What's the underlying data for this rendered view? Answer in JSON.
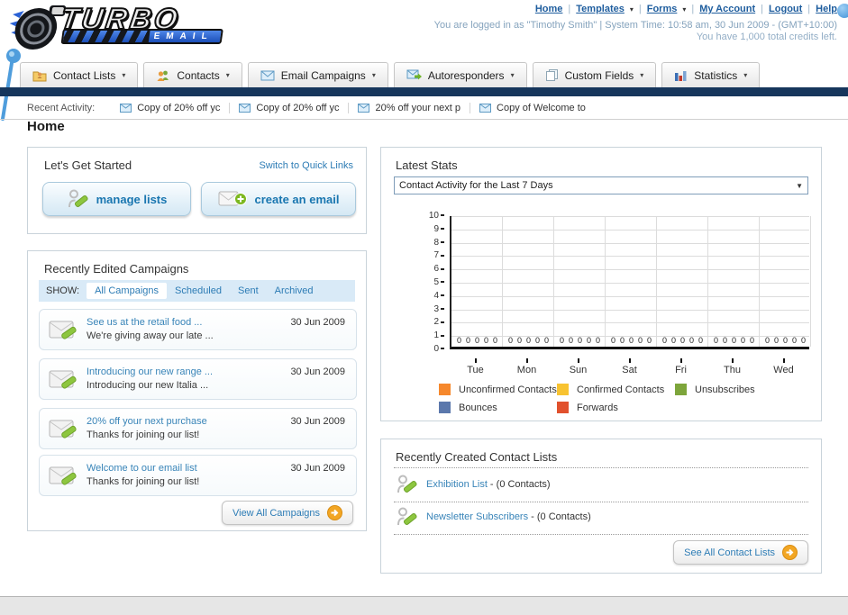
{
  "header": {
    "logo": {
      "title": "TURBO",
      "subtitle": "EMAIL"
    },
    "nav_links": [
      "Home",
      "Templates",
      "Forms",
      "My Account",
      "Logout",
      "Help"
    ],
    "login_line1": "You are logged in as \"Timothy Smith\" | System Time: 10:58 am, 30 Jun 2009 - (GMT+10:00)",
    "login_line2": "You have 1,000 total credits left."
  },
  "tabs": [
    {
      "label": "Contact Lists"
    },
    {
      "label": "Contacts"
    },
    {
      "label": "Email Campaigns"
    },
    {
      "label": "Autoresponders"
    },
    {
      "label": "Custom Fields"
    },
    {
      "label": "Statistics"
    }
  ],
  "recent_activity": {
    "label": "Recent Activity:",
    "items": [
      "Copy of 20% off yc",
      "Copy of 20% off yc",
      "20% off your next p",
      "Copy of Welcome to"
    ]
  },
  "page_title": "Home",
  "get_started": {
    "title": "Let's Get Started",
    "switch_link": "Switch to Quick Links",
    "manage_lists_label": "manage lists",
    "create_email_label": "create an email"
  },
  "campaigns_panel": {
    "title": "Recently Edited Campaigns",
    "show_label": "SHOW:",
    "filters": [
      "All Campaigns",
      "Scheduled",
      "Sent",
      "Archived"
    ],
    "active_filter": "All Campaigns",
    "rows": [
      {
        "title": "See us at the retail food ...",
        "subtitle": "We're giving away our late ...",
        "date": "30 Jun 2009"
      },
      {
        "title": "Introducing our new range ...",
        "subtitle": "Introducing our new Italia ...",
        "date": "30 Jun 2009"
      },
      {
        "title": "20% off your next purchase",
        "subtitle": "Thanks for joining our list!",
        "date": "30 Jun 2009"
      },
      {
        "title": "Welcome to our email list",
        "subtitle": "Thanks for joining our list!",
        "date": "30 Jun 2009"
      }
    ],
    "view_all": "View All Campaigns"
  },
  "stats_panel": {
    "title": "Latest Stats",
    "dropdown_value": "Contact Activity for the Last 7 Days"
  },
  "chart_data": {
    "type": "bar",
    "title": "Contact Activity for the Last 7 Days",
    "categories": [
      "Tue",
      "Mon",
      "Sun",
      "Sat",
      "Fri",
      "Thu",
      "Wed"
    ],
    "series": [
      {
        "name": "Unconfirmed Contacts",
        "color": "#F6882C",
        "values": [
          0,
          0,
          0,
          0,
          0,
          0,
          0
        ]
      },
      {
        "name": "Confirmed Contacts",
        "color": "#F8C331",
        "values": [
          0,
          0,
          0,
          0,
          0,
          0,
          0
        ]
      },
      {
        "name": "Unsubscribes",
        "color": "#7DA53B",
        "values": [
          0,
          0,
          0,
          0,
          0,
          0,
          0
        ]
      },
      {
        "name": "Bounces",
        "color": "#5B78AC",
        "values": [
          0,
          0,
          0,
          0,
          0,
          0,
          0
        ]
      },
      {
        "name": "Forwards",
        "color": "#E1512D",
        "values": [
          0,
          0,
          0,
          0,
          0,
          0,
          0
        ]
      }
    ],
    "xlabel": "",
    "ylabel": "",
    "ylim": [
      0,
      10
    ],
    "y_step": 1,
    "grid": true,
    "legend_position": "bottom",
    "data_labels_shown": true
  },
  "contact_lists_panel": {
    "title": "Recently Created Contact Lists",
    "items": [
      {
        "name": "Exhibition List",
        "suffix": " - (0 Contacts)"
      },
      {
        "name": "Newsletter Subscribers",
        "suffix": " - (0 Contacts)"
      }
    ],
    "see_all": "See All Contact Lists"
  }
}
